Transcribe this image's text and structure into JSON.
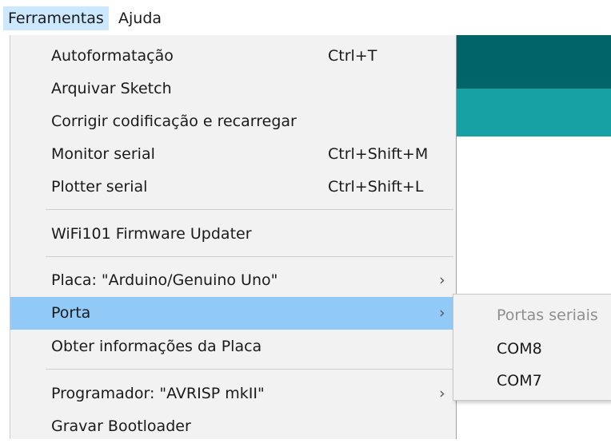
{
  "menubar": {
    "items": [
      {
        "label": "Ferramentas"
      },
      {
        "label": "Ajuda"
      }
    ]
  },
  "dropdown": {
    "items": [
      {
        "label": "Autoformatação",
        "shortcut": "Ctrl+T"
      },
      {
        "label": "Arquivar Sketch",
        "shortcut": ""
      },
      {
        "label": "Corrigir codificação e recarregar",
        "shortcut": ""
      },
      {
        "label": "Monitor serial",
        "shortcut": "Ctrl+Shift+M"
      },
      {
        "label": "Plotter serial",
        "shortcut": "Ctrl+Shift+L"
      },
      {
        "label": "WiFi101 Firmware Updater",
        "shortcut": ""
      },
      {
        "label": "Placa: \"Arduino/Genuino Uno\"",
        "shortcut": "",
        "submenu_arrow": "›"
      },
      {
        "label": "Porta",
        "shortcut": "",
        "submenu_arrow": "›"
      },
      {
        "label": "Obter informações da Placa",
        "shortcut": ""
      },
      {
        "label": "Programador: \"AVRISP mkII\"",
        "shortcut": "",
        "submenu_arrow": "›"
      },
      {
        "label": "Gravar Bootloader",
        "shortcut": ""
      }
    ]
  },
  "port_submenu": {
    "header": "Portas seriais",
    "items": [
      {
        "label": "COM8"
      },
      {
        "label": "COM7"
      }
    ]
  },
  "colors": {
    "highlight": "#91c9f7",
    "menu_bg": "#f2f2f2",
    "teal_dark": "#006468",
    "teal_light": "#17a1a5"
  }
}
